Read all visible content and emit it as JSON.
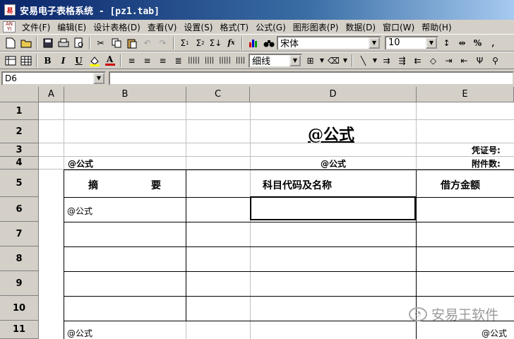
{
  "window": {
    "title": "安易电子表格系统 - [pz1.tab]"
  },
  "menu": [
    "文件(F)",
    "编辑(E)",
    "设计表格(D)",
    "查看(V)",
    "设置(S)",
    "格式(T)",
    "公式(G)",
    "图形图表(P)",
    "数据(D)",
    "窗口(W)",
    "帮助(H)"
  ],
  "toolbar1": {
    "font_name": "宋体",
    "font_size": "10",
    "percent_label": "%",
    "comma_label": ","
  },
  "toolbar2": {
    "bold": "B",
    "italic": "I",
    "underline": "U",
    "font_color": "A",
    "line_style": "细线"
  },
  "formula_bar": {
    "cell_ref": "D6",
    "content": ""
  },
  "columns": [
    "A",
    "B",
    "C",
    "D",
    "E"
  ],
  "rows": [
    "1",
    "2",
    "3",
    "4",
    "5",
    "6",
    "7",
    "8",
    "9",
    "10",
    "11"
  ],
  "cells": {
    "d2_title": "@公式",
    "e3_voucher": "凭证号:",
    "b4_formula": "@公式",
    "d4_formula": "@公式",
    "e4_attach": "附件数:",
    "b5_summary_a": "摘",
    "b5_summary_b": "要",
    "d5_account": "科目代码及名称",
    "e5_debit": "借方金额",
    "b6_formula": "@公式",
    "b11_formula": "@公式",
    "e11_formula": "@公式"
  },
  "watermark": {
    "text": "安易王软件"
  }
}
